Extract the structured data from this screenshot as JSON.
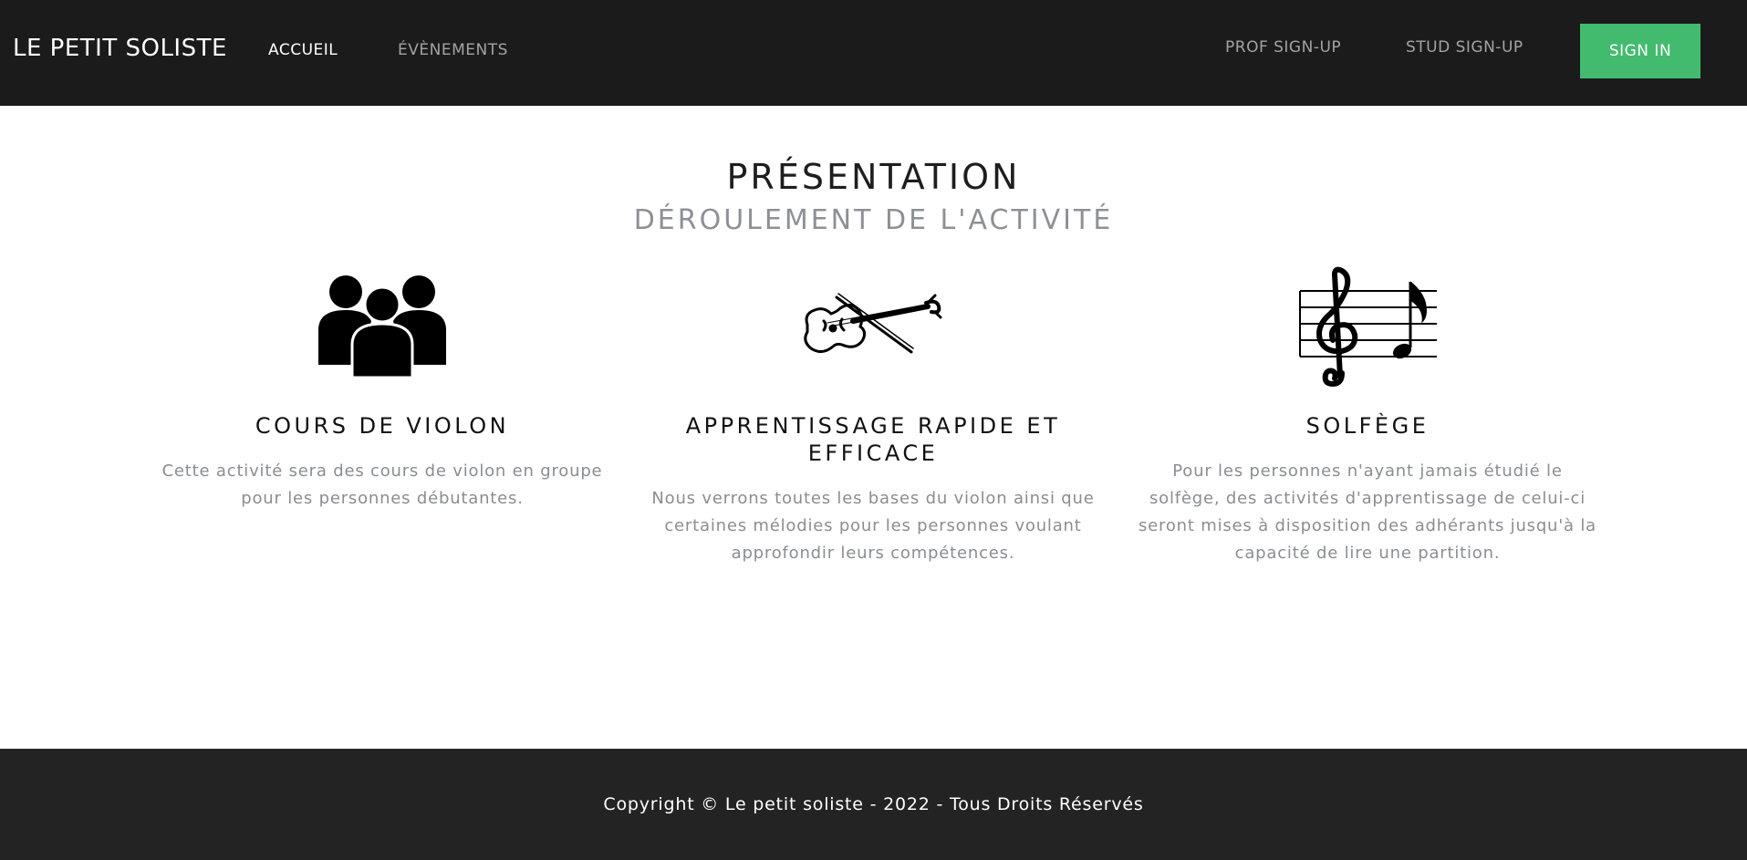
{
  "navbar": {
    "brand": "LE PETIT SOLISTE",
    "links": {
      "accueil": "ACCUEIL",
      "evenements": "ÉVÈNEMENTS",
      "prof_signup": "PROF SIGN-UP",
      "stud_signup": "STUD SIGN-UP"
    },
    "signin_label": "SIGN IN",
    "colors": {
      "background": "#1b1b1b",
      "active_link": "#ffffff",
      "inactive_link": "#a3a3a3",
      "signin_button": "#42bb6e"
    }
  },
  "presentation": {
    "title": "PRÉSENTATION",
    "subtitle": "DÉROULEMENT DE L'ACTIVITÉ",
    "features": [
      {
        "icon": "group-of-people-icon",
        "title": "COURS DE VIOLON",
        "text": "Cette activité sera des cours de violon en groupe pour les personnes débutantes."
      },
      {
        "icon": "violin-icon",
        "title": "APPRENTISSAGE RAPIDE ET EFFICACE",
        "text": "Nous verrons toutes les bases du violon ainsi que certaines mélodies pour les personnes voulant approfondir leurs compétences."
      },
      {
        "icon": "treble-clef-note-icon",
        "title": "SOLFÈGE",
        "text": "Pour les personnes n'ayant jamais étudié le solfège, des activités d'apprentissage de celui-ci seront mises à disposition des adhérants jusqu'à la capacité de lire une partition."
      }
    ]
  },
  "footer": {
    "copyright": "Copyright © Le petit soliste - 2022 - Tous Droits Réservés",
    "background": "#232323"
  }
}
